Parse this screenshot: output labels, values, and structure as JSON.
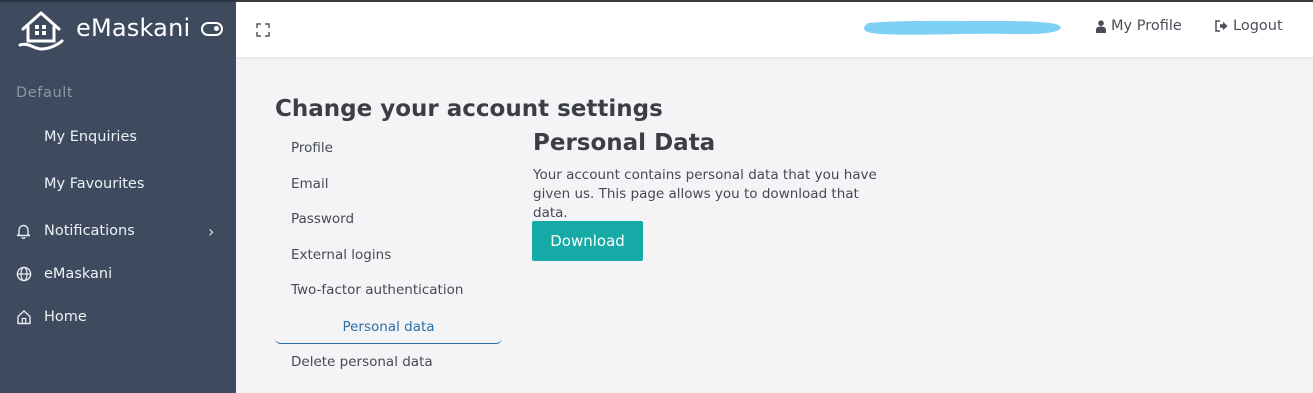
{
  "brand": {
    "name": "eMaskani",
    "logo_icon": "house-hand-logo-icon",
    "toggle_icon": "toggle-icon"
  },
  "sidebar": {
    "section_title": "Default",
    "items": [
      {
        "label": "My Enquiries",
        "icon": ""
      },
      {
        "label": "My Favourites",
        "icon": ""
      },
      {
        "label": "Notifications",
        "icon": "bell-icon",
        "has_children": true
      },
      {
        "label": "eMaskani",
        "icon": "globe-icon"
      },
      {
        "label": "Home",
        "icon": "home-icon"
      }
    ]
  },
  "topbar": {
    "fullscreen_icon": "fullscreen-icon",
    "user_name_redacted": true,
    "profile_label": "My Profile",
    "logout_label": "Logout"
  },
  "settings": {
    "title": "Change your account settings",
    "nav": [
      {
        "label": "Profile",
        "active": false
      },
      {
        "label": "Email",
        "active": false
      },
      {
        "label": "Password",
        "active": false
      },
      {
        "label": "External logins",
        "active": false
      },
      {
        "label": "Two-factor authentication",
        "active": false
      },
      {
        "label": "Personal data",
        "active": true
      },
      {
        "label": "Delete personal data",
        "active": false
      }
    ]
  },
  "content": {
    "title": "Personal Data",
    "description": "Your account contains personal data that you have given us. This page allows you to download that data.",
    "download_label": "Download"
  },
  "colors": {
    "sidebar_bg": "#3e4b5e",
    "accent": "#16aaa6",
    "active_link": "#2a6ea6",
    "redaction": "#7fd0f5"
  }
}
